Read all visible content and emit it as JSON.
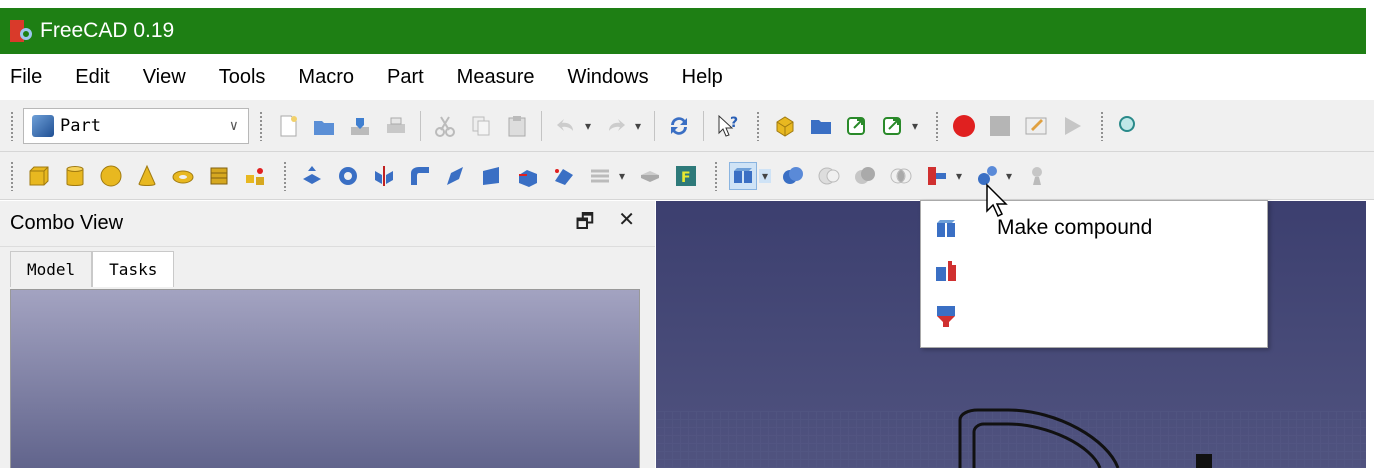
{
  "window": {
    "title": "FreeCAD 0.19"
  },
  "menubar": {
    "items": [
      "File",
      "Edit",
      "View",
      "Tools",
      "Macro",
      "Part",
      "Measure",
      "Windows",
      "Help"
    ]
  },
  "toolbar1": {
    "workbench_selected": "Part"
  },
  "combo_view": {
    "title": "Combo View",
    "float_icon": "🗗",
    "close_icon": "✕",
    "tabs": [
      "Model",
      "Tasks"
    ],
    "active_tab": "Tasks"
  },
  "compound_menu": {
    "items": [
      {
        "label": "Make compound",
        "icon": "compound-icon"
      },
      {
        "label": "",
        "icon": "explode-compound-icon"
      },
      {
        "label": "",
        "icon": "compound-filter-icon"
      }
    ]
  },
  "colors": {
    "titlebar": "#1e7f14",
    "record": "#e02020",
    "view_top": "#3c3f6f",
    "view_bottom": "#50537f"
  }
}
